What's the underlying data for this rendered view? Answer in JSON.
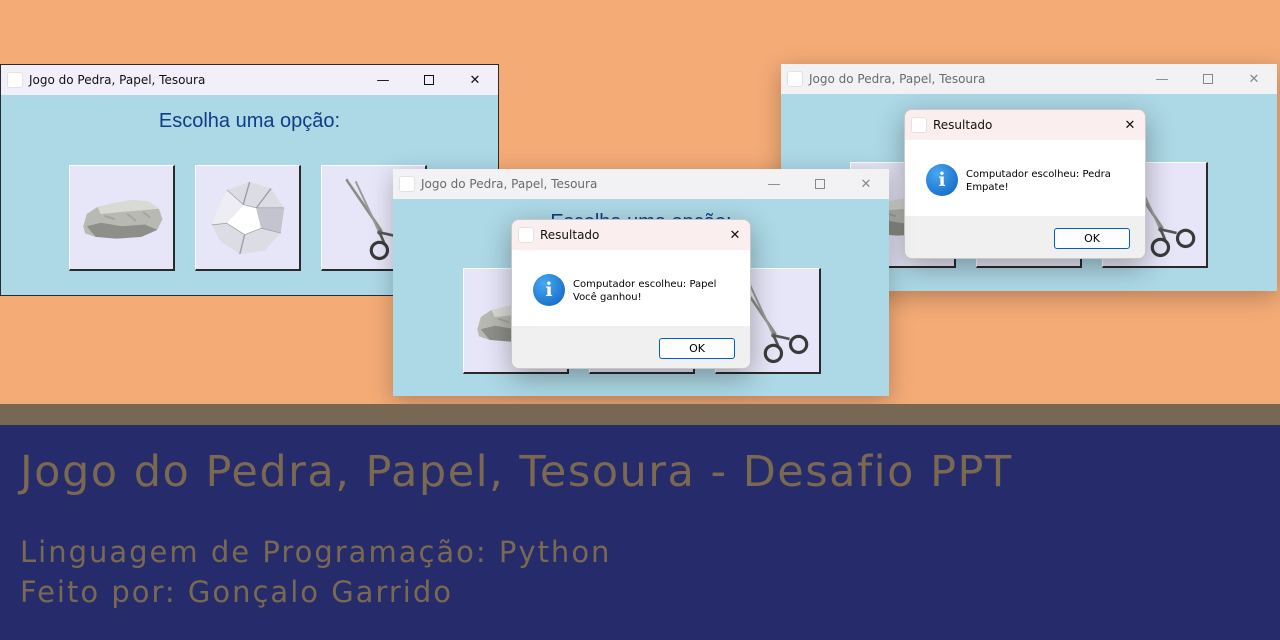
{
  "window_title": "Jogo do Pedra, Papel, Tesoura",
  "heading": "Escolha uma opção:",
  "choices": [
    {
      "name": "Pedra",
      "icon": "rock-icon"
    },
    {
      "name": "Papel",
      "icon": "crumpled-paper-icon"
    },
    {
      "name": "Tesoura",
      "icon": "scissors-icon"
    }
  ],
  "window_controls": {
    "minimize": "—",
    "maximize": "□",
    "close": "✕"
  },
  "dialogs": [
    {
      "title": "Resultado",
      "line1": "Computador escolheu: Papel",
      "line2": "Você ganhou!",
      "ok_label": "OK"
    },
    {
      "title": "Resultado",
      "line1": "Computador escolheu: Pedra",
      "line2": "Empate!",
      "ok_label": "OK"
    }
  ],
  "banner": {
    "title": "Jogo do Pedra, Papel, Tesoura - Desafio PPT",
    "language": "Linguagem de Programação: Python",
    "author": "Feito por: Gonçalo Garrido"
  },
  "colors": {
    "background": "#f4ab76",
    "window_bg": "#add8e6",
    "button_bg": "#e6e6f8",
    "heading_text": "#0f3e85",
    "banner_bg": "#252b6b",
    "banner_text": "#7a6950",
    "info_icon": "#0a60c2"
  }
}
